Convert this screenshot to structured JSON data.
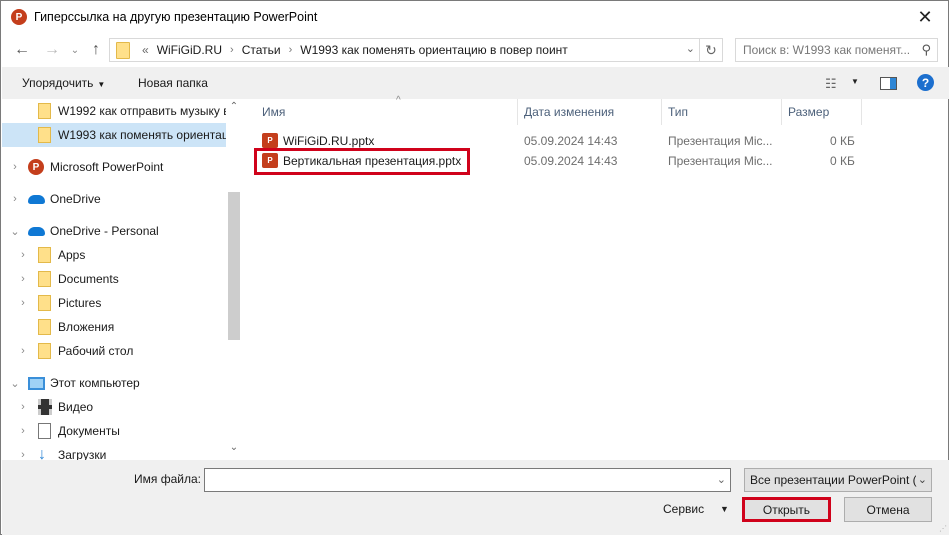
{
  "window": {
    "title": "Гиперссылка на другую презентацию PowerPoint",
    "app_icon": "powerpoint-icon",
    "close_icon": "close-icon"
  },
  "navigation": {
    "back_icon": "arrow-left-icon",
    "forward_icon": "arrow-right-icon",
    "recent_icon": "chevron-down-icon",
    "up_icon": "arrow-up-icon",
    "breadcrumb_prefix": "«",
    "breadcrumb": [
      "WiFiGiD.RU",
      "Статьи",
      "W1993 как поменять ориентацию в повер поинт"
    ],
    "refresh_icon": "refresh-icon",
    "search_placeholder": "Поиск в: W1993 как поменят...",
    "search_icon": "search-icon"
  },
  "toolbar": {
    "organize_label": "Упорядочить",
    "new_folder_label": "Новая папка",
    "view_icon": "view-list-icon",
    "preview_pane_icon": "preview-pane-icon",
    "help_label": "?"
  },
  "nav_tree": [
    {
      "label": "W1992 как отправить музыку в",
      "icon": "folder",
      "expandable": false,
      "level": 2,
      "selected": false
    },
    {
      "label": "W1993 как поменять ориентац",
      "icon": "folder",
      "expandable": false,
      "level": 2,
      "selected": true
    },
    {
      "label": "Microsoft PowerPoint",
      "icon": "powerpoint",
      "expandable": true,
      "level": 0,
      "selected": false
    },
    {
      "label": "OneDrive",
      "icon": "cloud",
      "expandable": true,
      "level": 0,
      "selected": false
    },
    {
      "label": "OneDrive - Personal",
      "icon": "cloud",
      "expandable": true,
      "expanded": true,
      "level": 0,
      "selected": false
    },
    {
      "label": "Apps",
      "icon": "folder",
      "expandable": true,
      "level": 1,
      "selected": false
    },
    {
      "label": "Documents",
      "icon": "folder",
      "expandable": true,
      "level": 1,
      "selected": false
    },
    {
      "label": "Pictures",
      "icon": "folder",
      "expandable": true,
      "level": 1,
      "selected": false
    },
    {
      "label": "Вложения",
      "icon": "folder",
      "expandable": false,
      "level": 1,
      "selected": false
    },
    {
      "label": "Рабочий стол",
      "icon": "folder",
      "expandable": true,
      "level": 1,
      "selected": false
    },
    {
      "label": "Этот компьютер",
      "icon": "computer",
      "expandable": true,
      "expanded": true,
      "level": 0,
      "selected": false
    },
    {
      "label": "Видео",
      "icon": "video",
      "expandable": true,
      "level": 1,
      "selected": false
    },
    {
      "label": "Документы",
      "icon": "document",
      "expandable": true,
      "level": 1,
      "selected": false
    },
    {
      "label": "Загрузки",
      "icon": "download",
      "expandable": true,
      "level": 1,
      "selected": false
    }
  ],
  "file_list": {
    "columns": [
      "Имя",
      "Дата изменения",
      "Тип",
      "Размер"
    ],
    "sort_indicator": "^",
    "files": [
      {
        "name": "WiFiGiD.RU.pptx",
        "date": "05.09.2024 14:43",
        "type": "Презентация Mic...",
        "size": "0 КБ",
        "highlighted": false
      },
      {
        "name": "Вертикальная презентация.pptx",
        "date": "05.09.2024 14:43",
        "type": "Презентация Mic...",
        "size": "0 КБ",
        "highlighted": true
      }
    ]
  },
  "bottom": {
    "filename_label": "Имя файла:",
    "filename_value": "",
    "filetype_value": "Все презентации PowerPoint (",
    "service_label": "Сервис",
    "open_label": "Открыть",
    "cancel_label": "Отмена"
  },
  "colors": {
    "highlight_border": "#d0021b",
    "selection": "#cce4f7",
    "powerpoint": "#c43e1c",
    "folder": "#ffe08a"
  }
}
